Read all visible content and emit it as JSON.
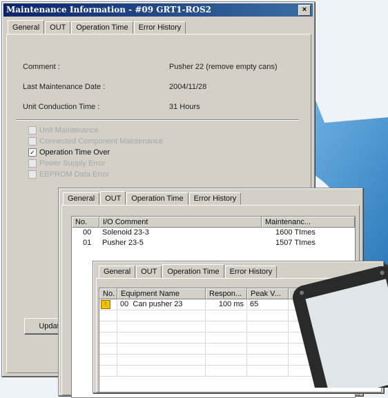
{
  "colors": {
    "title_bar": "#0a246a",
    "arrow": "#2e86c8",
    "device": "#2a2a2a"
  },
  "window1": {
    "title": "Maintenance Information - #09 GRT1-ROS2",
    "close": "×",
    "tabs": [
      "General",
      "OUT",
      "Operation Time",
      "Error History"
    ],
    "fields": [
      {
        "label": "Comment :",
        "value": "Pusher 22 (remove empty cans)"
      },
      {
        "label": "Last Maintenance Date :",
        "value": "2004/11/28"
      },
      {
        "label": "Unit Conduction Time :",
        "value": "31 Hours"
      }
    ],
    "checks": [
      {
        "label": "Unit Maintenance",
        "checked": false,
        "enabled": false
      },
      {
        "label": "Connected Component Maintenance",
        "checked": false,
        "enabled": false
      },
      {
        "label": "Operation Time Over",
        "checked": true,
        "enabled": true
      },
      {
        "label": "Power Supply Error",
        "checked": false,
        "enabled": false
      },
      {
        "label": "EEPROM Data Error",
        "checked": false,
        "enabled": false
      }
    ],
    "update_button": "Updat"
  },
  "window2": {
    "tabs": [
      "General",
      "OUT",
      "Operation Time",
      "Error History"
    ],
    "columns": [
      "No.",
      "I/O Comment",
      "Maintenanc..."
    ],
    "rows": [
      {
        "no": "00",
        "comment": "Solenoid 23-3",
        "value": "1600 TImes"
      },
      {
        "no": "01",
        "comment": "Pusher 23-5",
        "value": "1507 TImes"
      }
    ]
  },
  "window3": {
    "tabs": [
      "General",
      "OUT",
      "Operation Time",
      "Error History"
    ],
    "columns": [
      "No.",
      "Equipment Name",
      "Respon...",
      "Peak V...",
      ""
    ],
    "rows": [
      {
        "icon": "warning-icon",
        "no": "00",
        "name": "Can pusher 23",
        "resp": "100 ms",
        "peak": "65"
      }
    ]
  }
}
